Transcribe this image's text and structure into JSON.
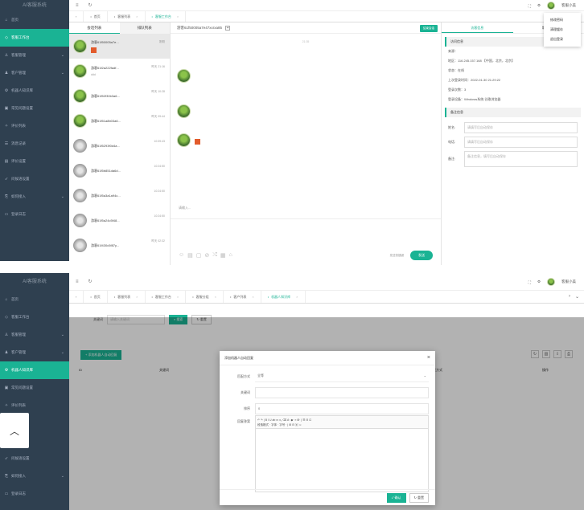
{
  "top": {
    "logo": "AI客服系统",
    "sidebar": [
      {
        "label": "首页",
        "icon": "home-icon",
        "glyph": "⌂",
        "active": false,
        "caret": false
      },
      {
        "label": "客服工作台",
        "icon": "desktop-icon",
        "glyph": "◇",
        "active": true,
        "caret": false
      },
      {
        "label": "客服管理",
        "icon": "user-icon",
        "glyph": "♙",
        "active": false,
        "caret": true
      },
      {
        "label": "客户管理",
        "icon": "users-icon",
        "glyph": "♟",
        "active": false,
        "caret": true
      },
      {
        "label": "机器人知识库",
        "icon": "robot-icon",
        "glyph": "⚙",
        "active": false,
        "caret": false
      },
      {
        "label": "常见问题设置",
        "icon": "question-icon",
        "glyph": "▣",
        "active": false,
        "caret": false
      },
      {
        "label": "评价列表",
        "icon": "star-icon",
        "glyph": "✧",
        "active": false,
        "caret": false
      },
      {
        "label": "消息记录",
        "icon": "message-icon",
        "glyph": "☰",
        "active": false,
        "caret": false
      },
      {
        "label": "评价设置",
        "icon": "settings-icon",
        "glyph": "▤",
        "active": false,
        "caret": false
      },
      {
        "label": "问候语设置",
        "icon": "send-icon",
        "glyph": "➶",
        "active": false,
        "caret": false
      },
      {
        "label": "如何接入",
        "icon": "link-icon",
        "glyph": "⎘",
        "active": false,
        "caret": true
      },
      {
        "label": "登录日志",
        "icon": "log-icon",
        "glyph": "▭",
        "active": false,
        "caret": false
      }
    ],
    "tabs": [
      {
        "label": "首页",
        "active": false,
        "closable": false
      },
      {
        "label": "客服列表",
        "active": false,
        "closable": true
      },
      {
        "label": "客服工作台",
        "active": true,
        "closable": true
      }
    ],
    "user_name": "客服小美",
    "user_menu": [
      "修改密码",
      "清理缓存",
      "退出登录"
    ],
    "chat_tabs": [
      "会话列表",
      "排队列表"
    ],
    "chats": [
      {
        "name": "游客61f50005a7e...",
        "time": "刚刚",
        "sub": "",
        "flag": true,
        "color": true,
        "selected": true
      },
      {
        "name": "游客61f2a222fadf...",
        "time": "昨天 21:16",
        "sub": "ddd",
        "flag": false,
        "color": true,
        "selected": false
      },
      {
        "name": "游客61f52f30b3a6...",
        "time": "昨天 10:28",
        "sub": "",
        "flag": false,
        "color": true,
        "selected": false
      },
      {
        "name": "游客61f51a8b03a6...",
        "time": "昨天 09:44",
        "sub": "",
        "flag": false,
        "color": true,
        "selected": false
      },
      {
        "name": "游客61f5293f0d4a...",
        "time": "10:39:43",
        "sub": "",
        "flag": false,
        "color": false,
        "selected": false
      },
      {
        "name": "游客61f5b851da6d...",
        "time": "10:24:50",
        "sub": "",
        "flag": false,
        "color": false,
        "selected": false
      },
      {
        "name": "游客61f5a3a1a94c...",
        "time": "10:24:50",
        "sub": "",
        "flag": false,
        "color": false,
        "selected": false
      },
      {
        "name": "游客61f5a24c5f48...",
        "time": "10:24:50",
        "sub": "",
        "flag": false,
        "color": false,
        "selected": false
      },
      {
        "name": "游客61f430c5f87y...",
        "time": "昨天 02:32",
        "sub": "",
        "flag": false,
        "color": false,
        "selected": false
      }
    ],
    "conv_title": "游客61f50005a7e47xxrxa85",
    "conv_btn": "结束会话",
    "conv_time": "21:35",
    "input_placeholder": "请输入...",
    "tool_icons": [
      "☺",
      "▤",
      "▢",
      "⊘",
      "⤮",
      "▦",
      "⌂"
    ],
    "send_hint": "发送快捷键",
    "send_label": "发送",
    "info_tabs": [
      "访客信息",
      "常见问题"
    ],
    "visitor_section": "访问信息",
    "visitor_rows": [
      "来源：",
      "地区：116.245.157.168 【中国，北京，北京】",
      "状态：在线",
      "上次登录时间：2022-01-30 21:29:22",
      "登录次数：3",
      "登录设备：Windows系统 谷歌浏览器"
    ],
    "remark_section": "备注信息",
    "form": [
      {
        "label": "姓名:",
        "placeholder": "请填写后自动保存"
      },
      {
        "label": "电话:",
        "placeholder": "请填写后自动保存"
      },
      {
        "label": "备注:",
        "placeholder": "备注信息，填写后自动保存"
      }
    ]
  },
  "bottom": {
    "logo": "AI客服系统",
    "sidebar": [
      {
        "label": "首页",
        "icon": "home-icon",
        "glyph": "⌂",
        "active": false,
        "caret": false
      },
      {
        "label": "客服工作台",
        "icon": "desktop-icon",
        "glyph": "◇",
        "active": false,
        "caret": false
      },
      {
        "label": "客服管理",
        "icon": "user-icon",
        "glyph": "♙",
        "active": false,
        "caret": true
      },
      {
        "label": "客户管理",
        "icon": "users-icon",
        "glyph": "♟",
        "active": false,
        "caret": true
      },
      {
        "label": "机器人知识库",
        "icon": "robot-icon",
        "glyph": "⚙",
        "active": true,
        "caret": false
      },
      {
        "label": "常见问题设置",
        "icon": "question-icon",
        "glyph": "▣",
        "active": false,
        "caret": false
      },
      {
        "label": "评价列表",
        "icon": "star-icon",
        "glyph": "✧",
        "active": false,
        "caret": false
      },
      {
        "label": "",
        "icon": "message-icon",
        "glyph": "",
        "active": false,
        "caret": false
      },
      {
        "label": "",
        "icon": "settings-icon",
        "glyph": "",
        "active": false,
        "caret": false
      },
      {
        "label": "问候语设置",
        "icon": "send-icon",
        "glyph": "➶",
        "active": false,
        "caret": false
      },
      {
        "label": "如何接入",
        "icon": "link-icon",
        "glyph": "⎘",
        "active": false,
        "caret": true
      },
      {
        "label": "登录日志",
        "icon": "log-icon",
        "glyph": "▭",
        "active": false,
        "caret": false
      }
    ],
    "tabs": [
      {
        "label": "首页",
        "active": false,
        "closable": false
      },
      {
        "label": "客服列表",
        "active": false,
        "closable": true
      },
      {
        "label": "客服工作台",
        "active": false,
        "closable": true
      },
      {
        "label": "客服分组",
        "active": false,
        "closable": true
      },
      {
        "label": "客户列表",
        "active": false,
        "closable": true
      },
      {
        "label": "机器人知识库",
        "active": true,
        "closable": true
      }
    ],
    "user_name": "客服小美",
    "search_label": "关键词",
    "search_placeholder": "请输入关键词",
    "search_btn": "搜索",
    "reset_btn": "重置",
    "add_btn": "+ 添加机器人自动回复",
    "table_headers": [
      "ID",
      "关键词",
      "回复方式",
      "操作"
    ],
    "modal": {
      "title": "添加机器人自动回复",
      "fields": [
        {
          "label": "匹配方式",
          "value": "全等"
        },
        {
          "label": "关键词",
          "value": ""
        },
        {
          "label": "排序",
          "value": "0"
        }
      ],
      "editor_label": "回复答案",
      "toolbar_line1": "↶ ↷ | B I U ab x² x₂ ⌫ A· ◆· ≡ ⊞· | ☰ ⊟ ⊡",
      "toolbar_line2": "段落格式 · 字体 · 字号 · | ⊞ ⊟ ▣ ☺",
      "confirm": "确认",
      "cancel": "重置"
    }
  }
}
